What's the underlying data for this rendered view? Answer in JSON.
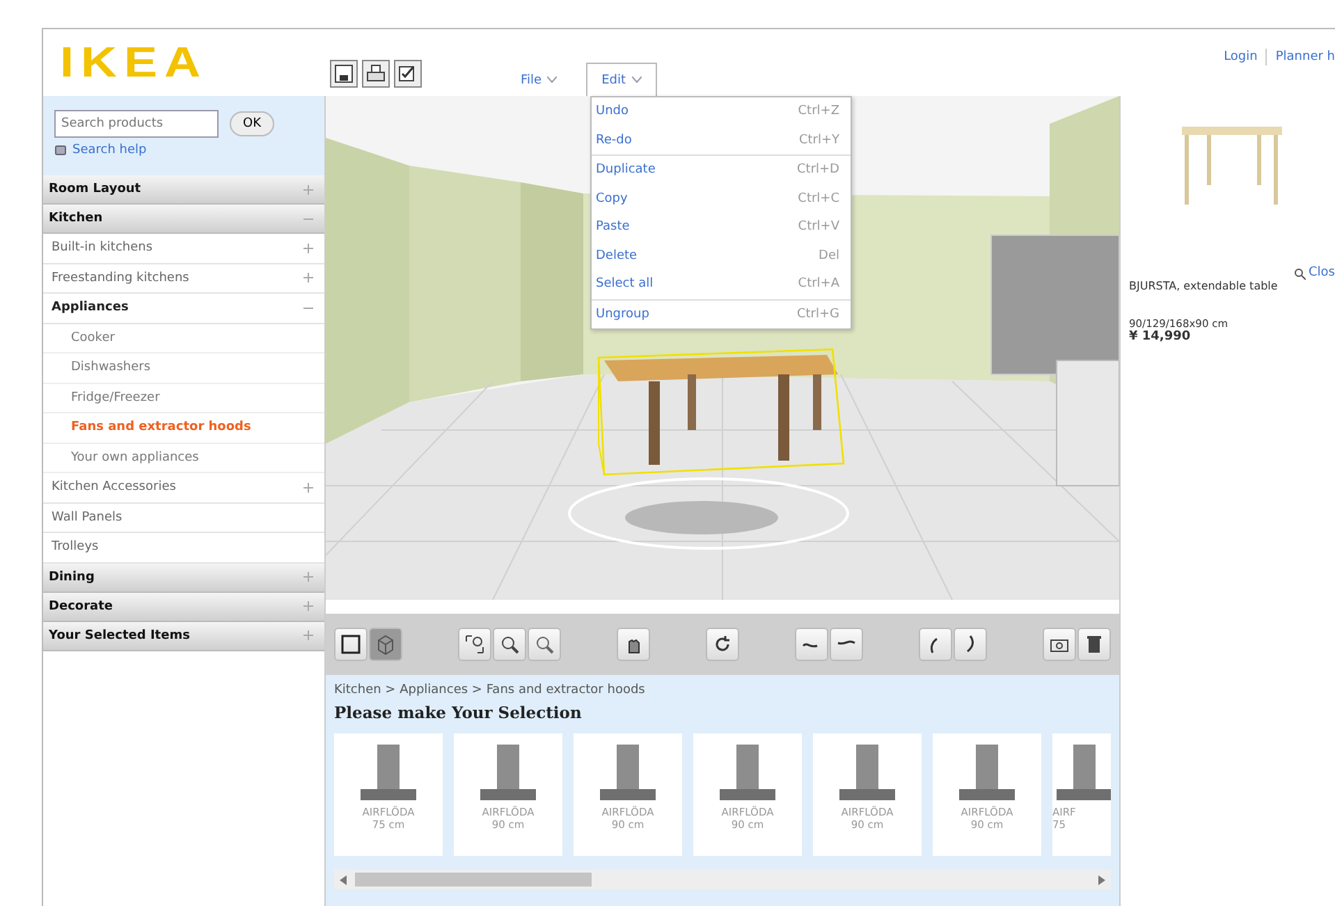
{
  "header": {
    "logo": "IKEA",
    "menus": [
      {
        "label": "File",
        "selected": false
      },
      {
        "label": "Edit",
        "selected": true
      }
    ],
    "links": [
      "Login",
      "Planner h"
    ]
  },
  "edit_menu": [
    {
      "label": "Undo",
      "shortcut": "Ctrl+Z"
    },
    {
      "label": "Re-do",
      "shortcut": "Ctrl+Y"
    },
    {
      "label": "Duplicate",
      "shortcut": "Ctrl+D"
    },
    {
      "label": "Copy",
      "shortcut": "Ctrl+C"
    },
    {
      "label": "Paste",
      "shortcut": "Ctrl+V"
    },
    {
      "label": "Delete",
      "shortcut": "Del"
    },
    {
      "label": "Select all",
      "shortcut": "Ctrl+A"
    },
    {
      "label": "Ungroup",
      "shortcut": "Ctrl+G"
    }
  ],
  "search": {
    "placeholder": "Search products",
    "button": "OK",
    "help": "Search help"
  },
  "sidebar": [
    {
      "label": "Room Layout",
      "expanded": false
    },
    {
      "label": "Kitchen",
      "expanded": true,
      "children": [
        {
          "label": "Built-in kitchens",
          "expanded": false
        },
        {
          "label": "Freestanding kitchens",
          "expanded": false
        },
        {
          "label": "Appliances",
          "expanded": true,
          "children": [
            {
              "label": "Cooker",
              "selected": false
            },
            {
              "label": "Dishwashers",
              "selected": false
            },
            {
              "label": "Fridge/Freezer",
              "selected": false
            },
            {
              "label": "Fans and extractor hoods",
              "selected": true
            },
            {
              "label": "Your own appliances",
              "selected": false
            }
          ]
        },
        {
          "label": "Kitchen Accessories",
          "expanded": false
        },
        {
          "label": "Wall Panels"
        },
        {
          "label": "Trolleys"
        }
      ]
    },
    {
      "label": "Dining",
      "expanded": false
    },
    {
      "label": "Decorate",
      "expanded": false
    },
    {
      "label": "Your Selected Items",
      "expanded": false
    }
  ],
  "view_buttons": [
    {
      "selected": false
    },
    {
      "selected": true
    }
  ],
  "breadcrumb": "Kitchen > Appliances > Fans and extractor hoods",
  "selection_title": "Please make Your Selection",
  "products": [
    {
      "name": "AIRFLÖDA",
      "size": "75 cm"
    },
    {
      "name": "AIRFLÖDA",
      "size": "90 cm"
    },
    {
      "name": "AIRFLÖDA",
      "size": "90 cm"
    },
    {
      "name": "AIRFLÖDA",
      "size": "90 cm"
    },
    {
      "name": "AIRFLÖDA",
      "size": "90 cm"
    },
    {
      "name": "AIRFLÖDA",
      "size": "90 cm"
    },
    {
      "name": "AIRF",
      "size": "75"
    }
  ],
  "details": {
    "close": "Clos",
    "name": "BJURSTA, extendable table",
    "dimensions": "90/129/168x90 cm",
    "price": "¥ 14,990"
  }
}
